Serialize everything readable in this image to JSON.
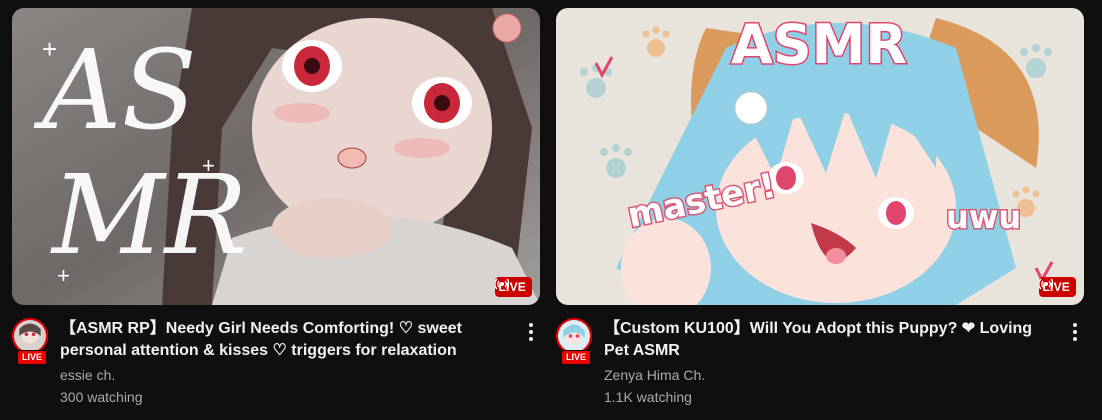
{
  "videos": [
    {
      "title": "【ASMR RP】Needy Girl Needs Comforting! ♡ sweet personal attention & kisses ♡ triggers for relaxation",
      "channel": "essie ch.",
      "watching": "300 watching",
      "live_label": "LIVE",
      "avatar_live_label": "LIVE",
      "thumbnail_text": "ASMR",
      "menu_icon": "more-vert-icon"
    },
    {
      "title": "【Custom KU100】Will You Adopt this Puppy? ❤ Loving Pet ASMR",
      "channel": "Zenya Hima Ch.",
      "watching": "1.1K watching",
      "live_label": "LIVE",
      "avatar_live_label": "LIVE",
      "thumbnail_text": "ASMR",
      "thumbnail_callouts": [
        "master!",
        "uwu"
      ],
      "menu_icon": "more-vert-icon"
    }
  ],
  "colors": {
    "background": "#0f0f0f",
    "live_red": "#cc0000",
    "text": "#f1f1f1",
    "secondary_text": "#aaaaaa"
  }
}
